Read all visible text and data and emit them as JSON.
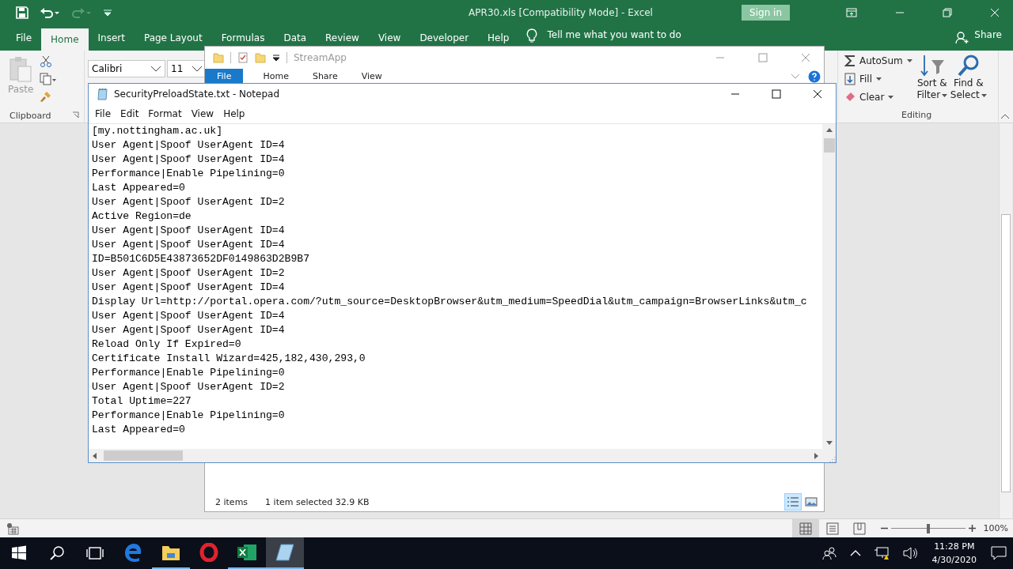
{
  "excel": {
    "title": "APR30.xls  [Compatibility Mode]  -  Excel",
    "sign_in": "Sign in",
    "tabs": [
      {
        "label": "File",
        "selected": false
      },
      {
        "label": "Home",
        "selected": true
      },
      {
        "label": "Insert",
        "selected": false
      },
      {
        "label": "Page Layout",
        "selected": false
      },
      {
        "label": "Formulas",
        "selected": false
      },
      {
        "label": "Data",
        "selected": false
      },
      {
        "label": "Review",
        "selected": false
      },
      {
        "label": "View",
        "selected": false
      },
      {
        "label": "Developer",
        "selected": false
      },
      {
        "label": "Help",
        "selected": false
      }
    ],
    "tell_me": "Tell me what you want to do",
    "share": "Share",
    "clipboard": {
      "paste": "Paste",
      "group": "Clipboard"
    },
    "font": {
      "name": "Calibri",
      "size": "11"
    },
    "editing": {
      "autosum": "AutoSum",
      "fill": "Fill",
      "clear": "Clear",
      "sort": [
        "Sort &",
        "Filter"
      ],
      "find": [
        "Find &",
        "Select"
      ],
      "group": "Editing"
    },
    "zoom": "100%",
    "zoom_slider": {
      "level": 0.5
    }
  },
  "explorer": {
    "title": "StreamApp",
    "tabs": [
      {
        "label": "File",
        "selected": true
      },
      {
        "label": "Home",
        "selected": false
      },
      {
        "label": "Share",
        "selected": false
      },
      {
        "label": "View",
        "selected": false
      }
    ],
    "items": "2 items",
    "selection": "1 item selected  32.9 KB"
  },
  "notepad": {
    "title": "SecurityPreloadState.txt - Notepad",
    "menu": [
      "File",
      "Edit",
      "Format",
      "View",
      "Help"
    ],
    "lines": [
      "[my.nottingham.ac.uk]",
      "User Agent|Spoof UserAgent ID=4",
      "User Agent|Spoof UserAgent ID=4",
      "Performance|Enable Pipelining=0",
      "Last Appeared=0",
      "User Agent|Spoof UserAgent ID=2",
      "Active Region=de",
      "User Agent|Spoof UserAgent ID=4",
      "User Agent|Spoof UserAgent ID=4",
      "ID=B501C6D5E43873652DF0149863D2B9B7",
      "User Agent|Spoof UserAgent ID=2",
      "User Agent|Spoof UserAgent ID=4",
      "Display Url=http://portal.opera.com/?utm_source=DesktopBrowser&utm_medium=SpeedDial&utm_campaign=BrowserLinks&utm_c",
      "User Agent|Spoof UserAgent ID=4",
      "User Agent|Spoof UserAgent ID=4",
      "Reload Only If Expired=0",
      "Certificate Install Wizard=425,182,430,293,0",
      "Performance|Enable Pipelining=0",
      "User Agent|Spoof UserAgent ID=2",
      "Total Uptime=227",
      "Performance|Enable Pipelining=0",
      "Last Appeared=0"
    ]
  },
  "taskbar": {
    "apps": [
      {
        "kind": "edge",
        "running": false,
        "selected": false
      },
      {
        "kind": "explorer",
        "running": true,
        "selected": false
      },
      {
        "kind": "opera",
        "running": false,
        "selected": false
      },
      {
        "kind": "excel",
        "running": true,
        "selected": false
      },
      {
        "kind": "notepad",
        "running": true,
        "selected": true
      }
    ],
    "time": "11:28 PM",
    "date": "4/30/2020"
  }
}
